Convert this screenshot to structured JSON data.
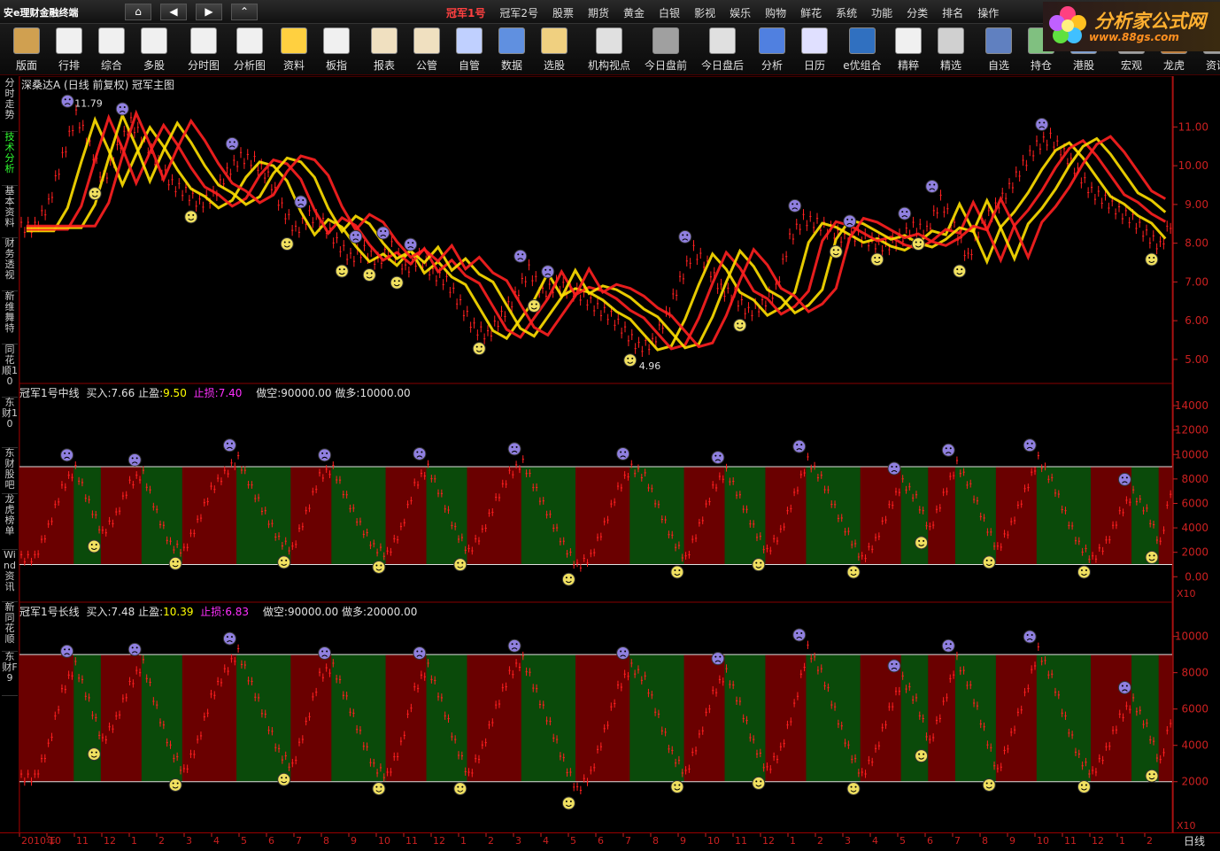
{
  "app": {
    "title": "安e理财金融终端"
  },
  "menu": [
    "冠军1号",
    "冠军2号",
    "股票",
    "期货",
    "黄金",
    "白银",
    "影视",
    "娱乐",
    "购物",
    "鲜花",
    "系统",
    "功能",
    "分类",
    "排名",
    "操作"
  ],
  "logo": {
    "text": "分析家公式网",
    "url": "www.88gs.com"
  },
  "toolbar": [
    {
      "label": "版面",
      "icon": "layout-icon"
    },
    {
      "label": "行排",
      "icon": "ranking-icon"
    },
    {
      "label": "综合",
      "icon": "summary-icon"
    },
    {
      "label": "多股",
      "icon": "multi-stock-icon"
    },
    {
      "label": "分时图",
      "icon": "intraday-icon"
    },
    {
      "label": "分析图",
      "icon": "candlestick-icon"
    },
    {
      "label": "资料",
      "icon": "f10-icon"
    },
    {
      "label": "板指",
      "icon": "sector-index-icon"
    },
    {
      "label": "报表",
      "icon": "report-icon"
    },
    {
      "label": "公管",
      "icon": "fund-icon"
    },
    {
      "label": "自管",
      "icon": "self-manage-icon"
    },
    {
      "label": "数据",
      "icon": "data-icon"
    },
    {
      "label": "选股",
      "icon": "stock-select-icon"
    },
    {
      "label": "机构视点",
      "icon": "institution-icon"
    },
    {
      "label": "今日盘前",
      "icon": "premarket-icon"
    },
    {
      "label": "今日盘后",
      "icon": "postmarket-icon"
    },
    {
      "label": "分析",
      "icon": "analysis-icon"
    },
    {
      "label": "日历",
      "icon": "calendar-icon"
    },
    {
      "label": "e优组合",
      "icon": "portfolio-icon"
    },
    {
      "label": "精粹",
      "icon": "essence-icon"
    },
    {
      "label": "精选",
      "icon": "selection-icon"
    },
    {
      "label": "自选",
      "icon": "watchlist-icon"
    },
    {
      "label": "持仓",
      "icon": "position-icon"
    },
    {
      "label": "港股",
      "icon": "hk-stock-icon"
    },
    {
      "label": "宏观",
      "icon": "macro-icon"
    },
    {
      "label": "龙虎",
      "icon": "dragon-tiger-icon"
    },
    {
      "label": "资讯",
      "icon": "news-icon"
    }
  ],
  "sidebar": [
    "分时走势",
    "技术分析",
    "基本资料",
    "财务透视",
    "新维舞特",
    "同花顺10",
    "东财10",
    "东财股吧",
    "龙虎榜单",
    "Wind资讯",
    "新同花顺",
    "东财F9"
  ],
  "colors": {
    "up": "#ff2020",
    "down": "#30e030",
    "bull_zone": "#6a0000",
    "bear_zone": "#0a4a0a",
    "title": "#e0e0e0",
    "buy": "#ffff00",
    "stop": "#ff30ff",
    "axis": "#cc2020"
  },
  "chart_data": [
    {
      "type": "line",
      "title": "深桑达A (日线 前复权) 冠军主图",
      "series": [
        {
          "name": "",
          "values": [
            8.4,
            9.0,
            10.2,
            11.3,
            10.5,
            9.6,
            10.4,
            11.1,
            10.6,
            10.0,
            9.5,
            9.3,
            9.0,
            9.2,
            9.8,
            10.2,
            10.1,
            9.7,
            8.9,
            8.3,
            8.7,
            8.5,
            8.0,
            7.6,
            7.8,
            7.5,
            7.9,
            7.3,
            7.6,
            7.2,
            7.0,
            6.4,
            5.8,
            5.6,
            6.1,
            6.6,
            7.3,
            6.7,
            6.9,
            6.8,
            6.6,
            6.3,
            6.1,
            5.7,
            5.3,
            5.4,
            6.1,
            7.0,
            7.8,
            7.4,
            6.8,
            6.6,
            6.2,
            6.4,
            6.8,
            8.1,
            8.6,
            8.5,
            8.3,
            8.1,
            8.2,
            8.0,
            7.9,
            8.1,
            8.4,
            8.3,
            9.1,
            8.4,
            7.6,
            8.5,
            8.9,
            9.4,
            10.0,
            10.5,
            10.7,
            10.3,
            9.8,
            9.3,
            9.1,
            8.8,
            8.6,
            8.2,
            7.9,
            8.7
          ]
        }
      ],
      "ylim": [
        4.7,
        11.9
      ],
      "yticks": [
        5.0,
        6.0,
        7.0,
        8.0,
        9.0,
        10.0,
        11.0
      ],
      "annotations": [
        {
          "text": "11.79"
        },
        {
          "text": "4.96"
        }
      ]
    },
    {
      "type": "line",
      "title": "冠军1号中线",
      "legend": {
        "buy_label": "买入:",
        "buy": "7.66",
        "tp_label": "止盈:",
        "tp": "9.50",
        "sl_label": "止损:",
        "sl": "7.40",
        "short_label": "做空:",
        "short": "90000.00",
        "long_label": "做多:",
        "long": "10000.00"
      },
      "ylim": [
        -1500,
        14800
      ],
      "yticks": [
        0,
        2000,
        4000,
        6000,
        8000,
        10000,
        12000,
        14000
      ],
      "upper_line": 9000,
      "lower_line": 1000,
      "scale_note": "X10",
      "series": [
        {
          "name": "",
          "values": [
            1500,
            4000,
            7200,
            8800,
            6000,
            3500,
            5000,
            7600,
            8400,
            5200,
            2600,
            2100,
            4400,
            7100,
            8400,
            9600,
            7200,
            5100,
            3000,
            2200,
            5100,
            8200,
            8800,
            6400,
            4200,
            2400,
            1800,
            3800,
            7400,
            8900,
            6500,
            3800,
            2000,
            3600,
            6200,
            8400,
            9300,
            7000,
            4800,
            2600,
            800,
            1600,
            4200,
            7100,
            8900,
            8200,
            5600,
            3100,
            1400,
            4100,
            7200,
            8600,
            6400,
            4000,
            2000,
            3600,
            6600,
            9500,
            8000,
            5600,
            3400,
            1400,
            2900,
            5600,
            7700,
            6400,
            3800,
            6600,
            9200,
            7300,
            4500,
            2200,
            4200,
            6900,
            9600,
            7800,
            5100,
            2600,
            1400,
            2700,
            5100,
            6800,
            5300,
            2600,
            8500
          ]
        }
      ]
    },
    {
      "type": "line",
      "title": "冠军1号长线",
      "legend": {
        "buy_label": "买入:",
        "buy": "7.48",
        "tp_label": "止盈:",
        "tp": "10.39",
        "sl_label": "止损:",
        "sl": "6.83",
        "short_label": "做空:",
        "short": "90000.00",
        "long_label": "做多:",
        "long": "20000.00"
      },
      "ylim": [
        -500,
        11200
      ],
      "yticks": [
        2000,
        4000,
        6000,
        8000,
        10000
      ],
      "upper_line": 9000,
      "lower_line": 2000,
      "scale_note": "X10",
      "series": [
        {
          "name": "",
          "values": [
            2200,
            3900,
            6900,
            8400,
            6400,
            4200,
            5400,
            7300,
            8500,
            6000,
            3800,
            2500,
            4100,
            6600,
            8000,
            9100,
            7300,
            5500,
            3600,
            2800,
            5100,
            7800,
            8300,
            6500,
            4600,
            2800,
            2300,
            4000,
            7000,
            8300,
            6400,
            4100,
            2300,
            3800,
            6000,
            7900,
            8700,
            6900,
            5100,
            3100,
            1500,
            2400,
            4700,
            7100,
            8300,
            7600,
            5500,
            3500,
            2400,
            4400,
            6800,
            8000,
            6200,
            4100,
            2600,
            3700,
            6100,
            9300,
            8000,
            5900,
            3800,
            2300,
            3600,
            5900,
            7600,
            6400,
            4100,
            6200,
            8700,
            7100,
            4800,
            2500,
            4500,
            6700,
            9200,
            7700,
            5400,
            3300,
            2400,
            3700,
            5500,
            6400,
            5000,
            3000,
            6200
          ]
        }
      ]
    }
  ],
  "timeline": {
    "labels": [
      "2010年",
      "10",
      "11",
      "12",
      "1",
      "2",
      "3",
      "4",
      "5",
      "6",
      "7",
      "8",
      "9",
      "10",
      "11",
      "12",
      "1",
      "2",
      "3",
      "4",
      "5",
      "6",
      "7",
      "8",
      "9",
      "10",
      "11",
      "12",
      "1",
      "2",
      "3",
      "4",
      "5",
      "6",
      "7",
      "8",
      "9",
      "10",
      "11",
      "12",
      "1",
      "2"
    ],
    "period": "日线"
  }
}
